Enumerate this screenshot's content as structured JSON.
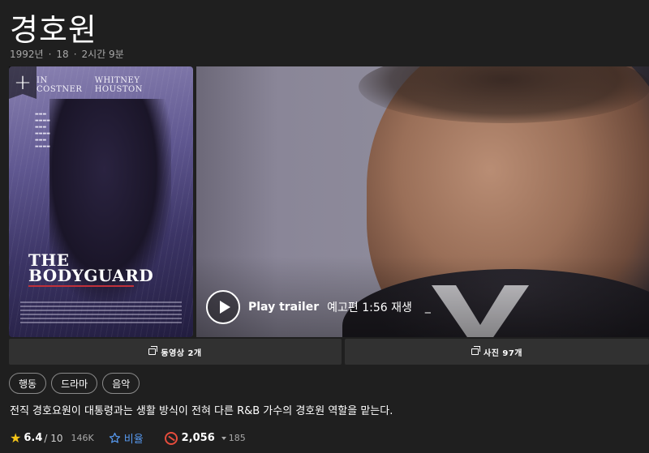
{
  "title": "경호원",
  "meta": {
    "year": "1992년",
    "rating": "18",
    "runtime": "2시간 9분"
  },
  "poster": {
    "cast_left": "IN COSTNER",
    "cast_right": "WHITNEY HOUSTON",
    "logo_line1": "THE",
    "logo_line2": "BODYGUARD"
  },
  "trailer": {
    "play_label": "Play trailer",
    "sub_label": "예고편 1:56 재생",
    "extra": "_"
  },
  "media": {
    "videos": "동영상 2개",
    "photos": "사진 97개"
  },
  "genres": [
    "행동",
    "드라마",
    "음악"
  ],
  "plot": "전직 경호요원이 대통령과는 생활 방식이 전혀 다른 R&B 가수의 경호원 역할을 맡는다.",
  "rating": {
    "score": "6.4",
    "out_of": "/ 10",
    "votes": "146K",
    "rate_label": "비율",
    "popularity": "2,056",
    "trend": "185"
  },
  "colors": {
    "background": "#1f1f1f",
    "star": "#f5c518",
    "link": "#5799ef",
    "popularity": "#e64c3c"
  }
}
